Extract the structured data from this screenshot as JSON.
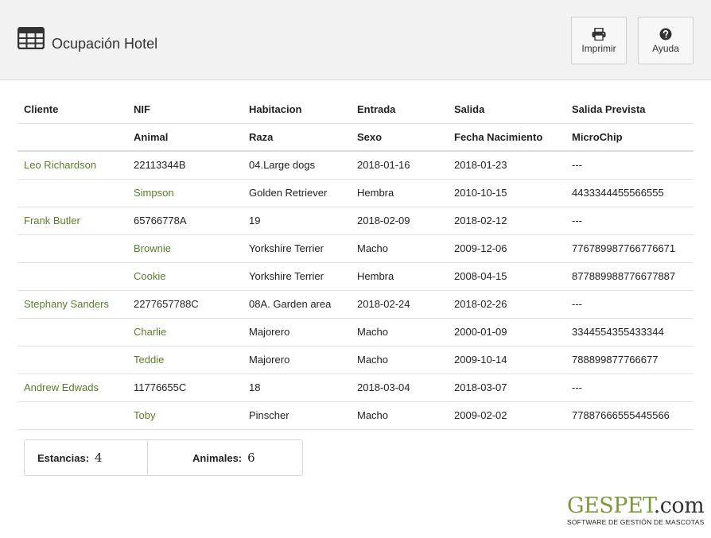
{
  "header": {
    "title": "Ocupación Hotel",
    "print_label": "Imprimir",
    "help_label": "Ayuda"
  },
  "table": {
    "headers_row1": [
      "Cliente",
      "NIF",
      "Habitacion",
      "Entrada",
      "Salida",
      "Salida Prevista"
    ],
    "headers_row2": [
      "",
      "Animal",
      "Raza",
      "Sexo",
      "Fecha Nacimiento",
      "MicroChip"
    ],
    "rows": [
      {
        "type": "client",
        "cells": [
          "Leo Richardson",
          "22113344B",
          "04.Large dogs",
          "2018-01-16",
          "2018-01-23",
          "---"
        ]
      },
      {
        "type": "animal",
        "cells": [
          "",
          "Simpson",
          "Golden Retriever",
          "Hembra",
          "2010-10-15",
          "4433344455566555"
        ]
      },
      {
        "type": "client",
        "cells": [
          "Frank Butler",
          "65766778A",
          "19",
          "2018-02-09",
          "2018-02-12",
          "---"
        ]
      },
      {
        "type": "animal",
        "cells": [
          "",
          "Brownie",
          "Yorkshire Terrier",
          "Macho",
          "2009-12-06",
          "776789987766776671"
        ]
      },
      {
        "type": "animal",
        "cells": [
          "",
          "Cookie",
          "Yorkshire Terrier",
          "Hembra",
          "2008-04-15",
          "877889988776677887"
        ]
      },
      {
        "type": "client",
        "cells": [
          "Stephany Sanders",
          "2277657788C",
          "08A. Garden area",
          "2018-02-24",
          "2018-02-26",
          "---"
        ]
      },
      {
        "type": "animal",
        "cells": [
          "",
          "Charlie",
          "Majorero",
          "Macho",
          "2000-01-09",
          "3344554355433344"
        ]
      },
      {
        "type": "animal",
        "cells": [
          "",
          "Teddie",
          "Majorero",
          "Macho",
          "2009-10-14",
          "788899877766677"
        ]
      },
      {
        "type": "client",
        "cells": [
          "Andrew Edwads",
          "11776655C",
          "18",
          "2018-03-04",
          "2018-03-07",
          "---"
        ]
      },
      {
        "type": "animal",
        "cells": [
          "",
          "Toby",
          "Pinscher",
          "Macho",
          "2009-02-02",
          "77887666555445566"
        ]
      }
    ]
  },
  "summary": {
    "stays_label": "Estancias:",
    "stays_value": "4",
    "animals_label": "Animales:",
    "animals_value": "6"
  },
  "brand": {
    "name_main": "GESPET",
    "name_dot": ".com",
    "tagline": "SOFTWARE DE GESTIÓN DE MASCOTAS"
  },
  "colors": {
    "link_green": "#5a7d2a",
    "brand_green": "#7a9a3c",
    "header_bg": "#f2f2f2"
  }
}
